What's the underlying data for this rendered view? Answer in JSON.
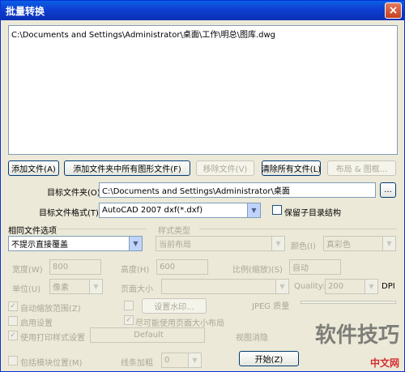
{
  "window": {
    "title": "批量转换",
    "close_glyph": "×"
  },
  "file_list": {
    "items": [
      "C:\\Documents and Settings\\Administrator\\桌面\\工作\\明总\\图库.dwg"
    ]
  },
  "buttons": {
    "add_file": "添加文件(A)",
    "add_folder": "添加文件夹中所有图形文件(F)",
    "remove_file": "移除文件(V)",
    "clear_all": "清除所有文件(L)",
    "layout": "布局 & 图框...",
    "browse": "...",
    "start": "开始(Z)"
  },
  "target_folder": {
    "label": "目标文件夹(O)",
    "value": "C:\\Documents and Settings\\Administrator\\桌面"
  },
  "target_format": {
    "label": "目标文件格式(T)",
    "value": "AutoCAD 2007 dxf(*.dxf)",
    "keep_dir_label": "保留子目录结构"
  },
  "same_file": {
    "label": "相同文件选项",
    "value": "不提示直接覆盖"
  },
  "style": {
    "label": "样式类型",
    "value": "当前布局"
  },
  "color": {
    "label": "颜色(I)",
    "value": "真彩色"
  },
  "width": {
    "label": "宽度(W)",
    "value": "800"
  },
  "height": {
    "label": "高度(H)",
    "value": "600"
  },
  "ratio": {
    "label": "比例(缩放)(S)",
    "value": "自动"
  },
  "unit": {
    "label": "单位(U)",
    "value": "像素"
  },
  "page_size": {
    "label": "页面大小"
  },
  "quality": {
    "label": "Quality:",
    "value": "200",
    "unit": "DPI"
  },
  "checks": {
    "auto_range": "自动缩放范围(Z)",
    "watermark": "设置水印...",
    "enable_settings": "启用设置",
    "use_page_size": "尽可能使用页面大小布局",
    "use_plot_style": "使用打印样式设置",
    "plot_style_value": "Default",
    "jpeg_quality": "JPEG 质量",
    "layer_hidden": "视图消隐",
    "include_ext": "包括模块位置(M)",
    "line_width": "线条加粗",
    "line_width_value": "0"
  },
  "watermark_text": {
    "main": "软件技巧",
    "brand": "中文网"
  }
}
